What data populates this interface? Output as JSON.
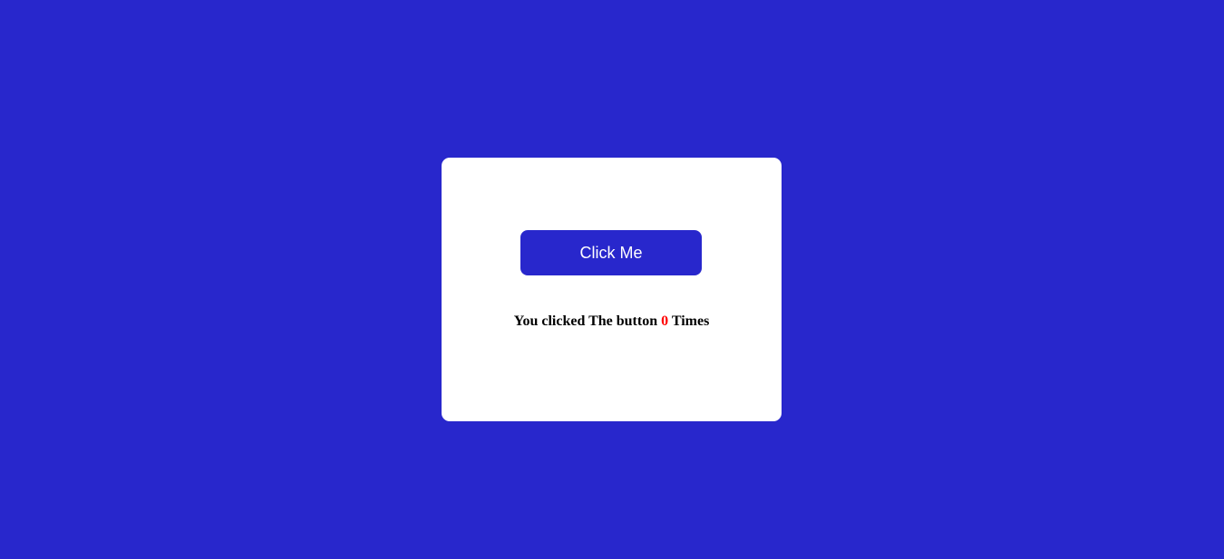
{
  "colors": {
    "background": "#2827cc",
    "card": "#ffffff",
    "button": "#2827cc",
    "button_text": "#ffffff",
    "count": "#ff0000"
  },
  "counter": {
    "button_label": "Click Me",
    "message_prefix": "You clicked The button",
    "count": "0",
    "message_suffix": "Times"
  }
}
